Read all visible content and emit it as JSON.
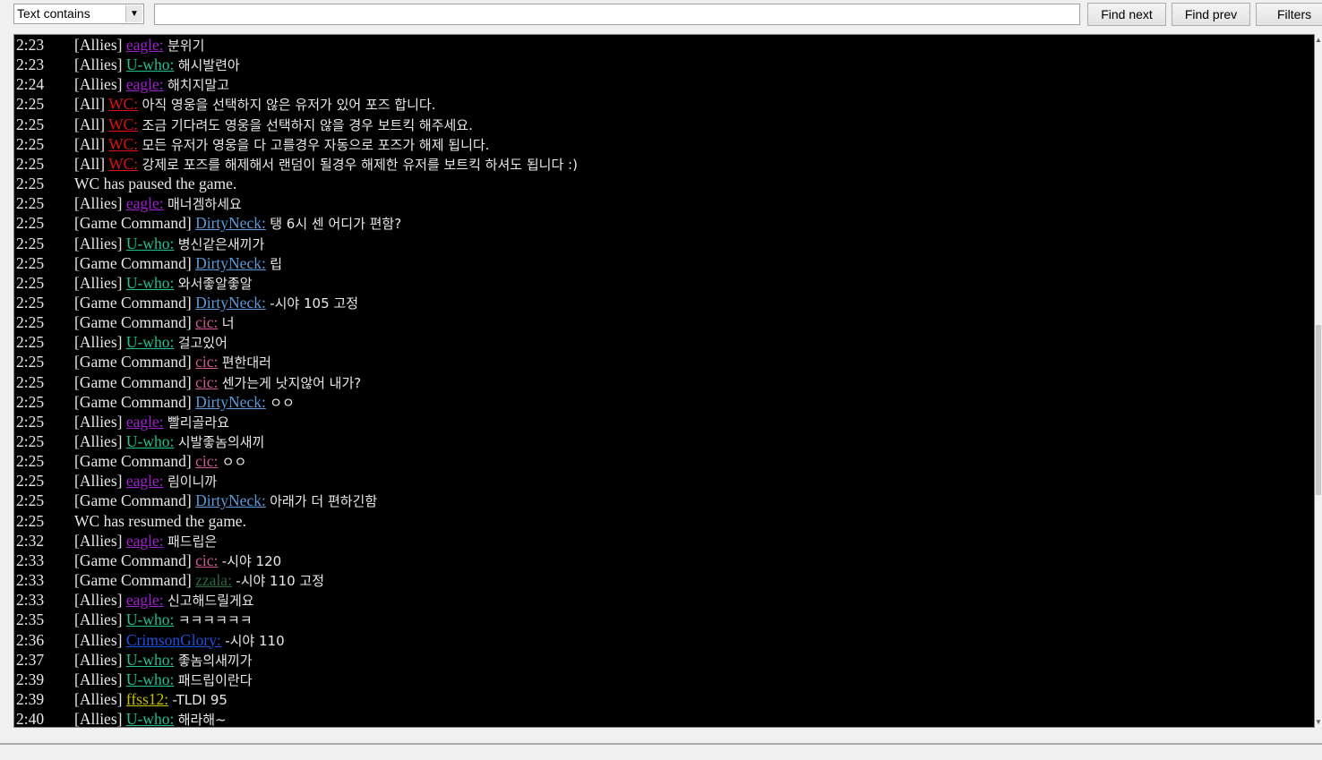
{
  "toolbar": {
    "filter_mode": "Text contains",
    "search_value": "",
    "find_next": "Find next",
    "find_prev": "Find prev",
    "filters": "Filters"
  },
  "colors": {
    "eagle": "#a020d0",
    "U-who": "#20c090",
    "WC": "#e01010",
    "DirtyNeck": "#5a9ad8",
    "cic": "#d05890",
    "zzala": "#2a6a40",
    "CrimsonGlory": "#2050e0",
    "ffss12": "#c8c000"
  },
  "log": [
    {
      "time": "2:23",
      "channel": "[Allies]",
      "name": "eagle:",
      "text": "분위기"
    },
    {
      "time": "2:23",
      "channel": "[Allies]",
      "name": "U-who:",
      "text": "해시발련아"
    },
    {
      "time": "2:24",
      "channel": "[Allies]",
      "name": "eagle:",
      "text": "해치지말고"
    },
    {
      "time": "2:25",
      "channel": "[All]",
      "name": "WC:",
      "text": "아직 영웅을 선택하지 않은 유저가 있어 포즈 합니다."
    },
    {
      "time": "2:25",
      "channel": "[All]",
      "name": "WC:",
      "text": "조금 기다려도 영웅을 선택하지 않을 경우 보트킥 해주세요."
    },
    {
      "time": "2:25",
      "channel": "[All]",
      "name": "WC:",
      "text": "모든 유저가 영웅을 다 고를경우 자동으로 포즈가 해제 됩니다."
    },
    {
      "time": "2:25",
      "channel": "[All]",
      "name": "WC:",
      "text": "강제로 포즈를 해제해서 랜덤이 될경우 해제한 유저를 보트킥 하셔도 됩니다 :)"
    },
    {
      "time": "2:25",
      "system": "WC has paused the game."
    },
    {
      "time": "2:25",
      "channel": "[Allies]",
      "name": "eagle:",
      "text": "매너겜하세요"
    },
    {
      "time": "2:25",
      "channel": "[Game Command]",
      "name": "DirtyNeck:",
      "text": "탱 6시 센 어디가 편함?"
    },
    {
      "time": "2:25",
      "channel": "[Allies]",
      "name": "U-who:",
      "text": "병신같은새끼가"
    },
    {
      "time": "2:25",
      "channel": "[Game Command]",
      "name": "DirtyNeck:",
      "text": "립"
    },
    {
      "time": "2:25",
      "channel": "[Allies]",
      "name": "U-who:",
      "text": "와서좋알좋알"
    },
    {
      "time": "2:25",
      "channel": "[Game Command]",
      "name": "DirtyNeck:",
      "text": "-시야 105 고정"
    },
    {
      "time": "2:25",
      "channel": "[Game Command]",
      "name": "cic:",
      "text": "너"
    },
    {
      "time": "2:25",
      "channel": "[Allies]",
      "name": "U-who:",
      "text": "걸고있어"
    },
    {
      "time": "2:25",
      "channel": "[Game Command]",
      "name": "cic:",
      "text": "편한대러"
    },
    {
      "time": "2:25",
      "channel": "[Game Command]",
      "name": "cic:",
      "text": "센가는게 낫지않어 내가?"
    },
    {
      "time": "2:25",
      "channel": "[Game Command]",
      "name": "DirtyNeck:",
      "text": "ㅇㅇ"
    },
    {
      "time": "2:25",
      "channel": "[Allies]",
      "name": "eagle:",
      "text": "빨리골라요"
    },
    {
      "time": "2:25",
      "channel": "[Allies]",
      "name": "U-who:",
      "text": "시발좋놈의새끼"
    },
    {
      "time": "2:25",
      "channel": "[Game Command]",
      "name": "cic:",
      "text": "ㅇㅇ"
    },
    {
      "time": "2:25",
      "channel": "[Allies]",
      "name": "eagle:",
      "text": "림이니까"
    },
    {
      "time": "2:25",
      "channel": "[Game Command]",
      "name": "DirtyNeck:",
      "text": "아래가 더 편하긴함"
    },
    {
      "time": "2:25",
      "system": "WC has resumed the game."
    },
    {
      "time": "2:32",
      "channel": "[Allies]",
      "name": "eagle:",
      "text": "패드립은"
    },
    {
      "time": "2:33",
      "channel": "[Game Command]",
      "name": "cic:",
      "text": "-시야 120"
    },
    {
      "time": "2:33",
      "channel": "[Game Command]",
      "name": "zzala:",
      "text": "-시야 110 고정"
    },
    {
      "time": "2:33",
      "channel": "[Allies]",
      "name": "eagle:",
      "text": "신고해드릴게요"
    },
    {
      "time": "2:35",
      "channel": "[Allies]",
      "name": "U-who:",
      "text": "ㅋㅋㅋㅋㅋㅋ"
    },
    {
      "time": "2:36",
      "channel": "[Allies]",
      "name": "CrimsonGlory:",
      "text": "-시야 110"
    },
    {
      "time": "2:37",
      "channel": "[Allies]",
      "name": "U-who:",
      "text": "좋놈의새끼가"
    },
    {
      "time": "2:39",
      "channel": "[Allies]",
      "name": "U-who:",
      "text": "패드립이란다"
    },
    {
      "time": "2:39",
      "channel": "[Allies]",
      "name": "ffss12:",
      "text": "-TLDI 95"
    },
    {
      "time": "2:40",
      "channel": "[Allies]",
      "name": "U-who:",
      "text": "해라해~"
    }
  ]
}
